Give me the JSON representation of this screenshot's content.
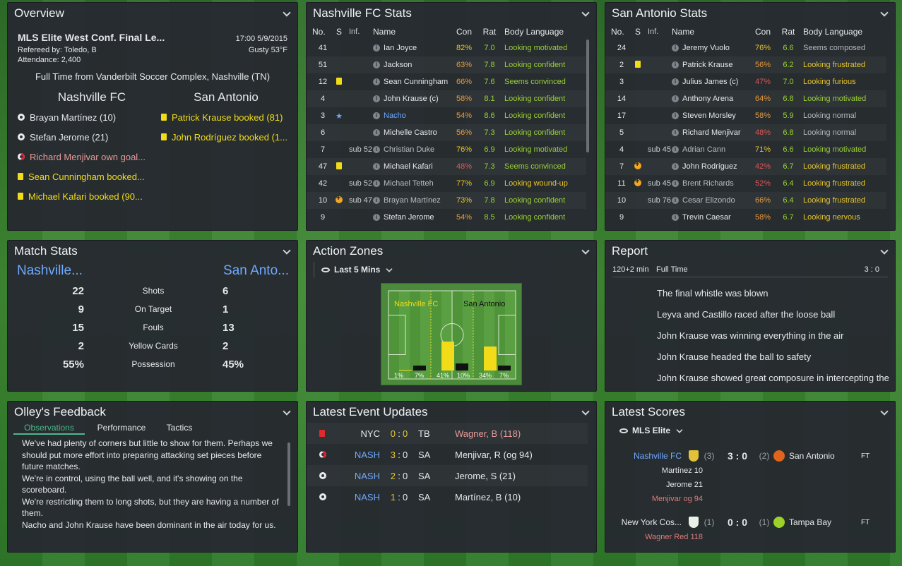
{
  "overview": {
    "title": "Overview",
    "competition": "MLS Elite West Conf. Final Le...",
    "datetime": "17:00 5/9/2015",
    "referee": "Refereed by: Toledo, B",
    "weather": "Gusty 53°F",
    "attendance": "Attendance: 2,400",
    "venue": "Full Time from Vanderbilt Soccer Complex, Nashville (TN)",
    "home": "Nashville FC",
    "away": "San Antonio",
    "home_events": [
      {
        "icon": "ball-icon",
        "text": "Brayan Martínez (10)"
      },
      {
        "icon": "ball-icon",
        "text": "Stefan Jerome (21)"
      },
      {
        "icon": "own-goal-icon",
        "text": "Richard Menjivar own goal..."
      },
      {
        "icon": "yellow-card-icon",
        "text": "Sean Cunningham booked..."
      },
      {
        "icon": "yellow-card-icon",
        "text": "Michael Kafari booked (90..."
      }
    ],
    "away_events": [
      {
        "icon": "yellow-card-icon",
        "text": "Patrick Krause booked (81)"
      },
      {
        "icon": "yellow-card-icon",
        "text": "John Rodríguez booked (1..."
      }
    ]
  },
  "stats_headers": {
    "no": "No.",
    "s": "S",
    "inf": "Inf.",
    "name": "Name",
    "con": "Con",
    "rat": "Rat",
    "bl": "Body Language"
  },
  "nashville_stats": {
    "title": "Nashville FC Stats",
    "rows": [
      {
        "no": "41",
        "s": "",
        "inf": "",
        "name": "Ian Joyce",
        "con": "82%",
        "rat": "7.0",
        "bl": "Looking motivated",
        "cc": "y",
        "bc": "g"
      },
      {
        "no": "51",
        "s": "",
        "inf": "",
        "name": "Jackson",
        "con": "63%",
        "rat": "7.8",
        "bl": "Looking confident",
        "cc": "o",
        "bc": "g"
      },
      {
        "no": "12",
        "s": "yellow-card-icon",
        "inf": "",
        "name": "Sean Cunningham",
        "con": "66%",
        "rat": "7.6",
        "bl": "Seems convinced",
        "cc": "o",
        "bc": "g"
      },
      {
        "no": "4",
        "s": "",
        "inf": "",
        "name": "John Krause (c)",
        "con": "58%",
        "rat": "8.1",
        "bl": "Looking confident",
        "cc": "o",
        "bc": "g"
      },
      {
        "no": "3",
        "s": "star-icon",
        "inf": "",
        "name": "Nacho",
        "con": "54%",
        "rat": "8.6",
        "bl": "Looking confident",
        "cc": "o",
        "bc": "g",
        "nc": "bl"
      },
      {
        "no": "6",
        "s": "",
        "inf": "",
        "name": "Michelle Castro",
        "con": "56%",
        "rat": "7.3",
        "bl": "Looking confident",
        "cc": "o",
        "bc": "g"
      },
      {
        "no": "7",
        "s": "",
        "inf": "sub 52",
        "name": "Christian Duke",
        "con": "76%",
        "rat": "6.9",
        "bl": "Looking motivated",
        "cc": "y",
        "bc": "g",
        "nc": "dim"
      },
      {
        "no": "47",
        "s": "yellow-card-icon",
        "inf": "",
        "name": "Michael Kafari",
        "con": "48%",
        "rat": "7.3",
        "bl": "Seems convinced",
        "cc": "r",
        "bc": "g"
      },
      {
        "no": "42",
        "s": "",
        "inf": "sub 52",
        "name": "Michael Tetteh",
        "con": "77%",
        "rat": "6.9",
        "bl": "Looking wound-up",
        "cc": "y",
        "bc": "y",
        "nc": "dim"
      },
      {
        "no": "10",
        "s": "sub-icon",
        "inf": "sub 47",
        "name": "Brayan Martínez",
        "con": "73%",
        "rat": "7.8",
        "bl": "Looking confident",
        "cc": "y",
        "bc": "g",
        "nc": "dim"
      },
      {
        "no": "9",
        "s": "",
        "inf": "",
        "name": "Stefan Jerome",
        "con": "54%",
        "rat": "8.5",
        "bl": "Looking confident",
        "cc": "o",
        "bc": "g"
      }
    ]
  },
  "sa_stats": {
    "title": "San Antonio Stats",
    "rows": [
      {
        "no": "24",
        "s": "",
        "inf": "",
        "name": "Jeremy Vuolo",
        "con": "76%",
        "rat": "6.6",
        "bl": "Seems composed",
        "cc": "y",
        "bc": "gr"
      },
      {
        "no": "2",
        "s": "yellow-card-icon",
        "inf": "",
        "name": "Patrick Krause",
        "con": "56%",
        "rat": "6.2",
        "bl": "Looking frustrated",
        "cc": "o",
        "bc": "y"
      },
      {
        "no": "3",
        "s": "",
        "inf": "",
        "name": "Julius James (c)",
        "con": "47%",
        "rat": "7.0",
        "bl": "Looking furious",
        "cc": "r",
        "bc": "y"
      },
      {
        "no": "14",
        "s": "",
        "inf": "",
        "name": "Anthony Arena",
        "con": "64%",
        "rat": "6.8",
        "bl": "Looking motivated",
        "cc": "o",
        "bc": "g"
      },
      {
        "no": "17",
        "s": "",
        "inf": "",
        "name": "Steven Morsley",
        "con": "58%",
        "rat": "5.9",
        "bl": "Looking normal",
        "cc": "o",
        "bc": "gr"
      },
      {
        "no": "5",
        "s": "",
        "inf": "",
        "name": "Richard Menjivar",
        "con": "48%",
        "rat": "6.8",
        "bl": "Looking normal",
        "cc": "r",
        "bc": "gr"
      },
      {
        "no": "4",
        "s": "",
        "inf": "sub 45",
        "name": "Adrian Cann",
        "con": "71%",
        "rat": "6.6",
        "bl": "Looking motivated",
        "cc": "y",
        "bc": "g",
        "nc": "dim"
      },
      {
        "no": "7",
        "s": "sub-icon",
        "inf": "",
        "name": "John Rodríguez",
        "con": "42%",
        "rat": "6.7",
        "bl": "Looking frustrated",
        "cc": "r",
        "bc": "y"
      },
      {
        "no": "11",
        "s": "sub-icon",
        "inf": "sub 45",
        "name": "Brent Richards",
        "con": "52%",
        "rat": "6.4",
        "bl": "Looking frustrated",
        "cc": "r",
        "bc": "y",
        "nc": "dim"
      },
      {
        "no": "10",
        "s": "",
        "inf": "sub 76",
        "name": "Cesar Elizondo",
        "con": "66%",
        "rat": "6.4",
        "bl": "Looking frustrated",
        "cc": "o",
        "bc": "y",
        "nc": "dim"
      },
      {
        "no": "9",
        "s": "",
        "inf": "",
        "name": "Trevin Caesar",
        "con": "58%",
        "rat": "6.7",
        "bl": "Looking nervous",
        "cc": "o",
        "bc": "y"
      }
    ]
  },
  "match_stats": {
    "title": "Match Stats",
    "home": "Nashville...",
    "away": "San Anto...",
    "rows": [
      {
        "h": "22",
        "l": "Shots",
        "a": "6"
      },
      {
        "h": "9",
        "l": "On Target",
        "a": "1"
      },
      {
        "h": "15",
        "l": "Fouls",
        "a": "13"
      },
      {
        "h": "2",
        "l": "Yellow Cards",
        "a": "2"
      },
      {
        "h": "55%",
        "l": "Possession",
        "a": "45%"
      }
    ]
  },
  "action_zones": {
    "title": "Action Zones",
    "filter": "Last 5 Mins",
    "home": "Nashville FC",
    "away": "San Antonio",
    "zones": [
      {
        "home": 1,
        "away": 7,
        "hl": "1%",
        "al": "7%"
      },
      {
        "home": 41,
        "away": 10,
        "hl": "41%",
        "al": "10%"
      },
      {
        "home": 34,
        "away": 7,
        "hl": "34%",
        "al": "7%"
      }
    ]
  },
  "report": {
    "title": "Report",
    "time": "120+2 min",
    "status": "Full Time",
    "score": "3 : 0",
    "lines": [
      "The final whistle was blown",
      "Leyva and Castillo raced after the loose ball",
      "John Krause was winning everything in the air",
      "John Krause headed the ball to safety",
      "John Krause showed great composure in intercepting the ball"
    ]
  },
  "feedback": {
    "title": "Olley's Feedback",
    "tabs": [
      "Observations",
      "Performance",
      "Tactics"
    ],
    "paragraphs": [
      "We've had plenty of corners but little to show for them. Perhaps we should put more effort into preparing attacking set pieces before future matches.",
      "We're in control, using the ball well, and it's showing on the scoreboard.",
      "We're restricting them to long shots, but they are having a number of them.",
      "Nacho and John Krause have been dominant in the air today for us."
    ]
  },
  "events": {
    "title": "Latest Event Updates",
    "rows": [
      {
        "icon": "red-card-icon",
        "team": "NYC",
        "hs": "0",
        "as": "0",
        "opp": "TB",
        "desc": "Wagner, B (118)",
        "tc": "w",
        "dc": "pk",
        "hc": "y",
        "ac": "y"
      },
      {
        "icon": "own-goal-icon",
        "team": "NASH",
        "hs": "3",
        "as": "0",
        "opp": "SA",
        "desc": "Menjivar, R (og 94)",
        "tc": "bl",
        "dc": "w",
        "hc": "y",
        "ac": "w"
      },
      {
        "icon": "ball-icon",
        "team": "NASH",
        "hs": "2",
        "as": "0",
        "opp": "SA",
        "desc": "Jerome, S (21)",
        "tc": "bl",
        "dc": "w",
        "hc": "y",
        "ac": "w"
      },
      {
        "icon": "ball-icon",
        "team": "NASH",
        "hs": "1",
        "as": "0",
        "opp": "SA",
        "desc": "Martínez, B (10)",
        "tc": "bl",
        "dc": "w",
        "hc": "y",
        "ac": "w"
      }
    ]
  },
  "scores": {
    "title": "Latest Scores",
    "filter": "MLS Elite",
    "matches": [
      {
        "home": "Nashville FC",
        "hseed": "(3)",
        "score": "3 : 0",
        "aseed": "(2)",
        "away": "San Antonio",
        "status": "FT",
        "scorers": [
          "Martínez 10",
          "Jerome 21",
          "Menjivar og 94"
        ]
      },
      {
        "home": "New York Cos...",
        "hseed": "(1)",
        "score": "0 : 0",
        "aseed": "(1)",
        "away": "Tampa Bay",
        "status": "FT",
        "scorers": [
          "Wagner Red 118"
        ]
      }
    ]
  }
}
